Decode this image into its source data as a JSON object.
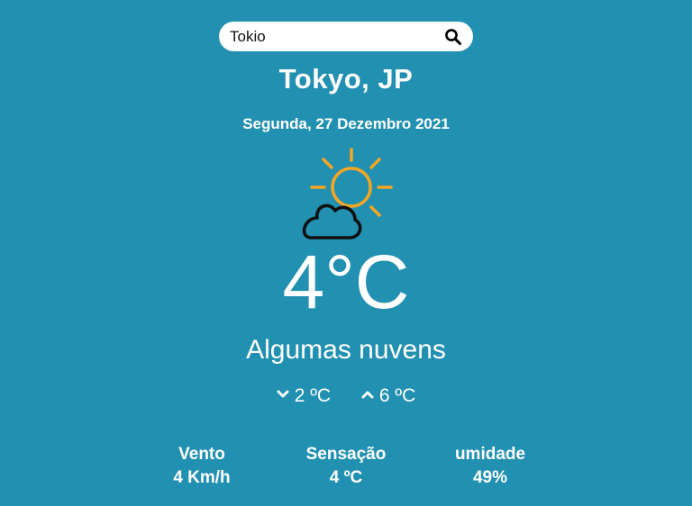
{
  "search": {
    "value": "Tokio",
    "icon": "search-icon"
  },
  "location": {
    "city": "Tokyo, JP",
    "date": "Segunda, 27 Dezembro 2021"
  },
  "weather": {
    "icon": "sun-cloud-icon",
    "temperature": "4°C",
    "description": "Algumas nuvens",
    "min": "2 ºC",
    "max": "6 ºC"
  },
  "stats": {
    "wind_label": "Vento",
    "wind_value": "4 Km/h",
    "feels_label": "Sensação",
    "feels_value": "4 ºC",
    "humidity_label": "umidade",
    "humidity_value": "49%"
  },
  "colors": {
    "background": "#2290b0",
    "sun": "#f5a623",
    "text": "#ffffff"
  }
}
